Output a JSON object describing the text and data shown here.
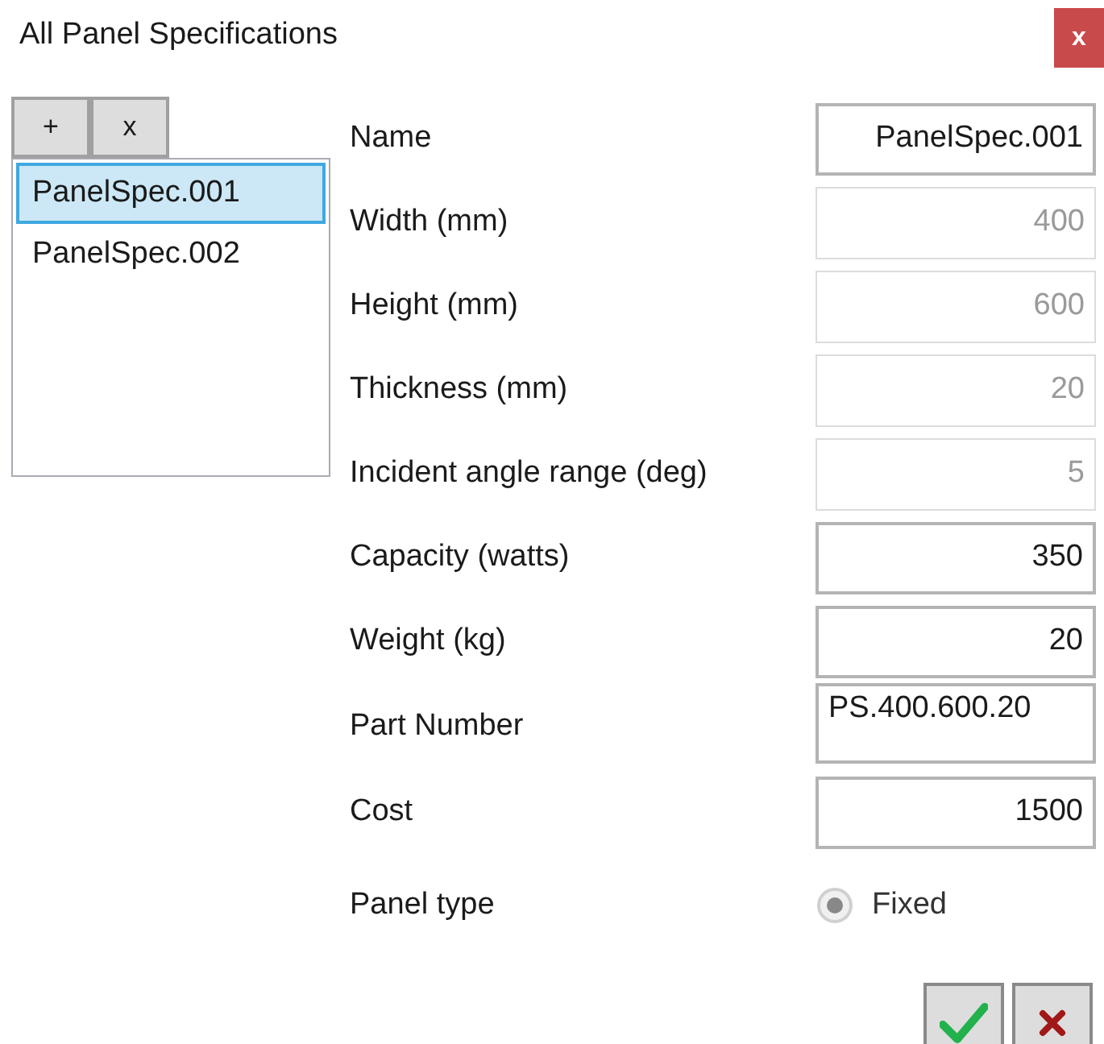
{
  "window": {
    "title": "All Panel Specifications",
    "close": "x"
  },
  "toolbar": [
    "+",
    "x"
  ],
  "list": [
    {
      "label": "PanelSpec.001",
      "selected": true
    },
    {
      "label": "PanelSpec.002",
      "selected": false
    }
  ],
  "fields": [
    {
      "label": "Name",
      "value": "PanelSpec.001",
      "disabled": false,
      "multiline": false
    },
    {
      "label": "Width (mm)",
      "value": "400",
      "disabled": true,
      "multiline": false
    },
    {
      "label": "Height (mm)",
      "value": "600",
      "disabled": true,
      "multiline": false
    },
    {
      "label": "Thickness (mm)",
      "value": "20",
      "disabled": true,
      "multiline": false
    },
    {
      "label": "Incident angle range (deg)",
      "value": "5",
      "disabled": true,
      "multiline": false
    },
    {
      "label": "Capacity (watts)",
      "value": "350",
      "disabled": false,
      "multiline": false
    },
    {
      "label": "Weight (kg)",
      "value": "20",
      "disabled": false,
      "multiline": false
    },
    {
      "label": "Part Number",
      "value": "PS.400.600.20",
      "disabled": false,
      "multiline": true
    },
    {
      "label": "Cost",
      "value": "1500",
      "disabled": false,
      "multiline": false
    }
  ],
  "panel_type": {
    "label": "Panel type",
    "option": {
      "label": "Fixed",
      "selected": true,
      "disabled": true
    }
  }
}
